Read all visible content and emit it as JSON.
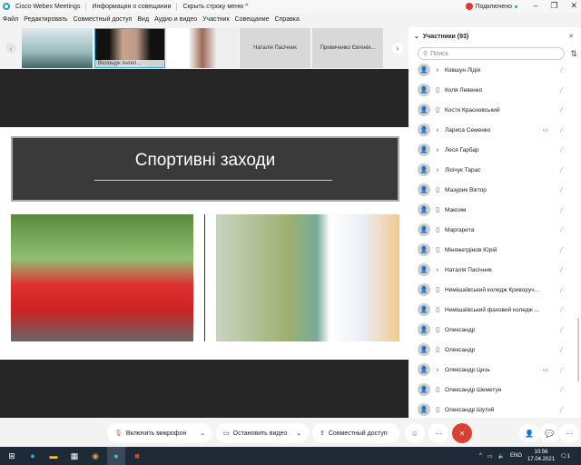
{
  "titlebar": {
    "app": "Cisco Webex Meetings",
    "info": "Информация о совещании",
    "hide": "Скрыть строку меню ^",
    "status": "Подключено"
  },
  "menu": [
    "Файл",
    "Редактировать",
    "Совместный доступ",
    "Вид",
    "Аудио и видео",
    "Участник",
    "Совещание",
    "Справка"
  ],
  "strip": {
    "tiles": [
      "",
      "Волощук Ангел...",
      "",
      "Наталія Пасічник",
      "Привиченко Євгенія..."
    ]
  },
  "slide": {
    "title": "Спортивні заходи"
  },
  "participants": {
    "title": "Участники (93)",
    "search_placeholder": "Поиск",
    "rows": [
      {
        "name": "Ковшун Лідія",
        "device": "mic",
        "video": false
      },
      {
        "name": "Коля Левенко",
        "device": "phone",
        "video": false
      },
      {
        "name": "Костя Красновський",
        "device": "phone",
        "video": false
      },
      {
        "name": "Лариса Семенко",
        "device": "mic",
        "video": true
      },
      {
        "name": "Леся Гарбар",
        "device": "mic",
        "video": false
      },
      {
        "name": "Лісічук Тарас",
        "device": "mic",
        "video": false
      },
      {
        "name": "Мазурик Віктор",
        "device": "phone",
        "video": false
      },
      {
        "name": "Максим",
        "device": "phone",
        "video": false
      },
      {
        "name": "Маргарита",
        "device": "phone",
        "video": false
      },
      {
        "name": "Міняжетдінов Юрій",
        "device": "phone",
        "video": false
      },
      {
        "name": "Наталія Пасічник",
        "device": "mic",
        "video": false
      },
      {
        "name": "Немішаївський коледж Криворуч...",
        "device": "phone",
        "video": false
      },
      {
        "name": "Немішаївський фаховий коледж ...",
        "device": "phone",
        "video": false
      },
      {
        "name": "Олександр",
        "device": "phone",
        "video": false
      },
      {
        "name": "Олександр",
        "device": "phone",
        "video": false
      },
      {
        "name": "Олександр Цизь",
        "device": "mic",
        "video": true
      },
      {
        "name": "Олександр Шеметун",
        "device": "phone",
        "video": false
      },
      {
        "name": "Олександр Шутий",
        "device": "phone",
        "video": false
      }
    ]
  },
  "controls": {
    "mic": "Включить микрофон",
    "video": "Остановить видео",
    "share": "Совместный доступ"
  },
  "taskbar": {
    "lang": "ENG",
    "time": "10:56",
    "date": "17.04.2021",
    "notifications": "1"
  },
  "colors": {
    "end": "#d9402e",
    "accent": "#1aa0c8"
  }
}
